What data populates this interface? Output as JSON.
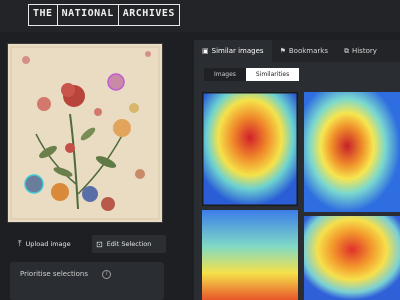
{
  "header": {
    "logo_words": [
      "THE",
      "NATIONAL",
      "ARCHIVES"
    ]
  },
  "left_panel": {
    "upload_label": "Upload image",
    "edit_label": "Edit Selection",
    "prioritise_label": "Prioritise selections"
  },
  "right_panel": {
    "tabs": [
      {
        "label": "Similar images",
        "icon": "image-icon",
        "active": true
      },
      {
        "label": "Bookmarks",
        "icon": "bookmark-icon",
        "active": false
      },
      {
        "label": "History",
        "icon": "history-icon",
        "active": false
      }
    ],
    "subtabs": [
      {
        "label": "Images",
        "active": false
      },
      {
        "label": "Similarities",
        "active": true
      }
    ]
  },
  "colors": {
    "background": "#1d1f23",
    "panel": "#2a2d32",
    "header": "#222428",
    "active_subtab": "#ffffff"
  }
}
